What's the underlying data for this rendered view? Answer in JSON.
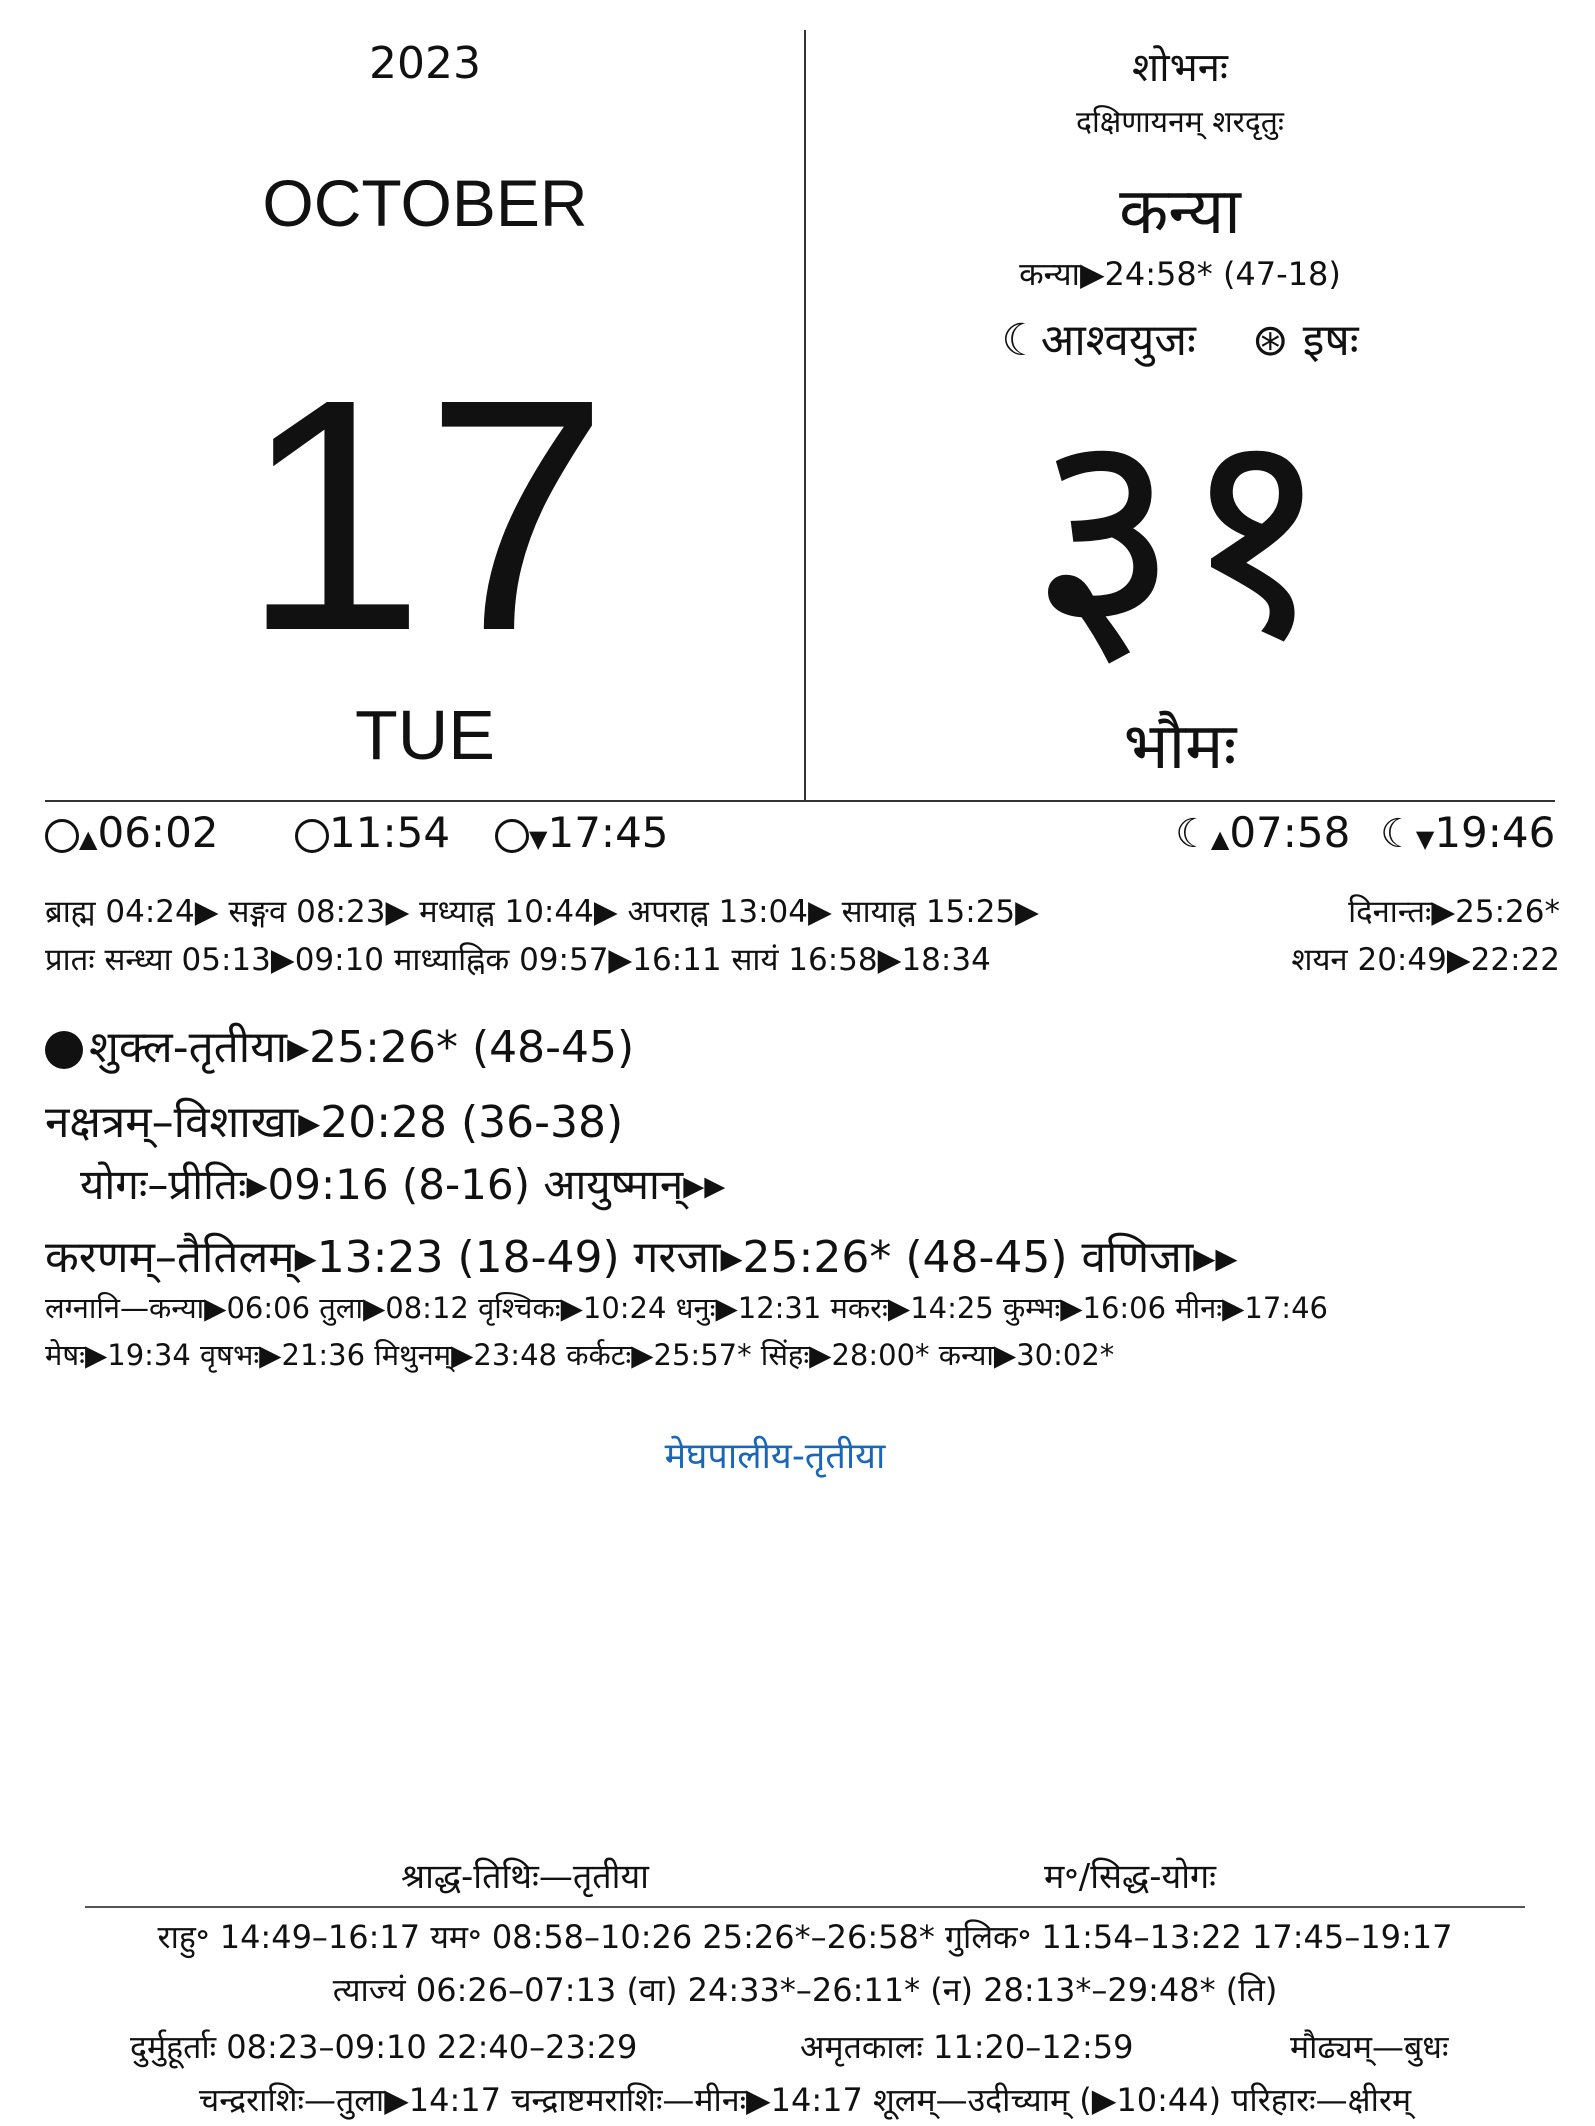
{
  "left": {
    "year": "2023",
    "month": "OCTOBER",
    "day": "17",
    "weekday": "TUE"
  },
  "right": {
    "yoga_name": "शोभनः",
    "ayana_ritu": "दक्षिणायनम्   शरदृतुः",
    "rashi": "कन्या",
    "rashi_time": "कन्या▶24:58* (47-18)",
    "lunar_month": "☾आश्वयुजः",
    "solar_month": "⊛ इषः",
    "saura_date": "३१",
    "vaara": "भौमः"
  },
  "sun_moon": {
    "sunrise": "06:02",
    "noon": "11:54",
    "sunset": "17:45",
    "moonrise": "07:58",
    "moonset": "19:46"
  },
  "muhurta": {
    "line1": "ब्राह्म 04:24▶ सङ्गव 08:23▶ मध्याह्न 10:44▶ अपराह्न 13:04▶ सायाह्न 15:25▶",
    "dinanta": "दिनान्तः▶25:26*",
    "line2": "प्रातः सन्ध्या 05:13▶09:10 माध्याह्निक 09:57▶16:11 सायं 16:58▶18:34",
    "shayana": "शयन 20:49▶22:22"
  },
  "panchanga": {
    "tithi": "शुक्ल-तृतीया▸25:26* (48-45)",
    "nakshatra": "नक्षत्रम्–विशाखा▸20:28 (36-38)",
    "yoga": "योगः–प्रीतिः▸09:16 (8-16)  आयुष्मान्▸▸",
    "karana": "करणम्–तैतिलम्▸13:23 (18-49)  गरजा▸25:26* (48-45)  वणिजा▸▸"
  },
  "lagna": {
    "line1": "लग्नानि—कन्या▶06:06  तुला▶08:12  वृश्चिकः▶10:24  धनुः▶12:31  मकरः▶14:25  कुम्भः▶16:06  मीनः▶17:46",
    "line2": "मेषः▶19:34  वृषभः▶21:36  मिथुनम्▶23:48  कर्कटः▶25:57*  सिंहः▶28:00*  कन्या▶30:02*"
  },
  "festival": "मेघपालीय-तृतीया",
  "bottom": {
    "sraddha": "श्राद्ध-तिथिः—तृतीया",
    "siddha": "म॰/सिद्ध-योगः",
    "rahu_line": "राहु॰  14:49–16:17    यम॰  08:58–10:26  25:26*–26:58*    गुलिक॰  11:54–13:22  17:45–19:17",
    "tyajya": "त्याज्यं  06:26–07:13 (वा)  24:33*–26:11* (न)  28:13*–29:48* (ति)",
    "durmuhurta": "दुर्मुहूर्ताः  08:23–09:10    22:40–23:29",
    "amrita": "अमृतकालः  11:20–12:59",
    "maudhya": "मौढ्यम्—बुधः",
    "last": "चन्द्रराशिः—तुला▶14:17   चन्द्राष्टमराशिः—मीनः▶14:17   शूलम्—उदीच्याम् (▶10:44) परिहारः—क्षीरम्"
  }
}
